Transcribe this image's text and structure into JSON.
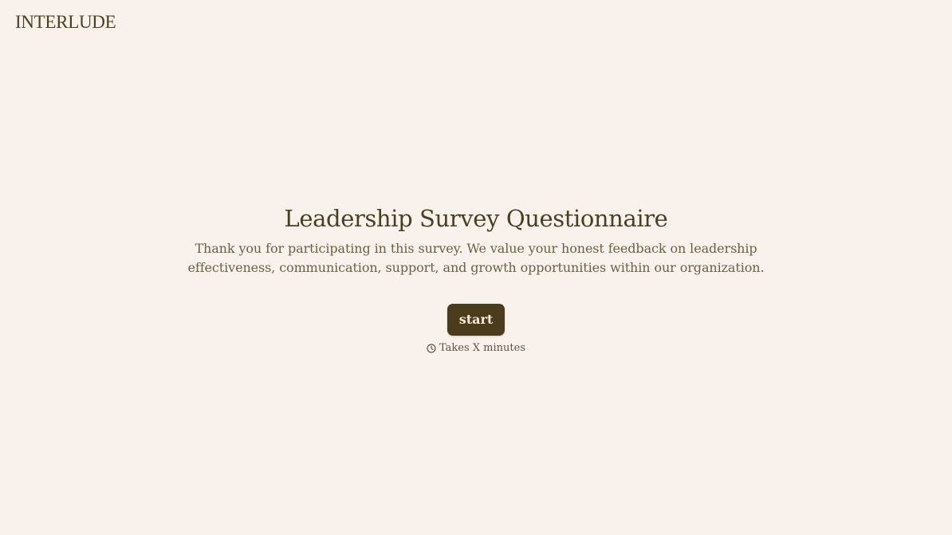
{
  "brand": {
    "name": "INTERLUDE"
  },
  "survey": {
    "title": "Leadership Survey Questionnaire",
    "description": "Thank you for participating in this survey. We value your honest feedback on leadership effectiveness, communication, support, and growth opportunities within our organization.",
    "start_label": "start",
    "duration_text": "Takes X minutes",
    "duration_icon": "clock-icon"
  },
  "colors": {
    "background": "#f9f2ec",
    "text_primary": "#4a3f22",
    "text_secondary": "#6b6047",
    "button_bg": "#4a3c1c",
    "button_text": "#f6ead3"
  }
}
